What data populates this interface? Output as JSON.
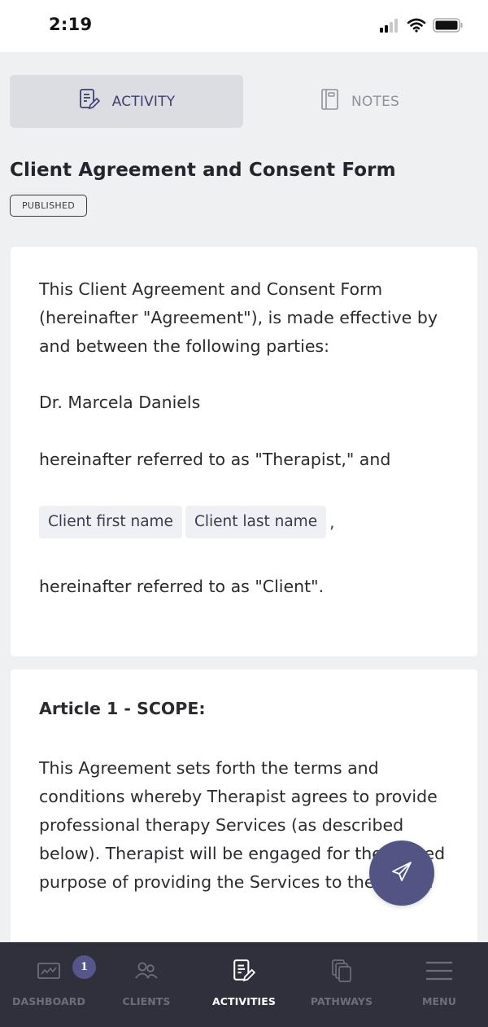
{
  "status_bar": {
    "time": "2:19",
    "icons": [
      "cellular-signal-icon",
      "wifi-icon",
      "battery-icon"
    ]
  },
  "tabs": [
    {
      "label": "ACTIVITY",
      "icon": "edit-document-icon",
      "active": true
    },
    {
      "label": "NOTES",
      "icon": "notebook-icon",
      "active": false
    }
  ],
  "page": {
    "title": "Client Agreement and Consent Form",
    "status_badge": "PUBLISHED"
  },
  "card1": {
    "intro": "This Client Agreement and Consent Form (hereinafter \"Agreement\"), is made effective by and between the following parties:",
    "therapist_name": "Dr. Marcela Daniels",
    "therapist_ref": "hereinafter referred to as \"Therapist,\" and",
    "fields": [
      {
        "label": "Client first name"
      },
      {
        "label": "Client last name"
      }
    ],
    "fields_suffix": ",",
    "client_ref": "hereinafter referred to as \"Client\"."
  },
  "card2": {
    "heading": "Article 1 - SCOPE:",
    "body": "This Agreement sets forth the terms and conditions whereby Therapist agrees to provide professional therapy Services (as described below). Therapist will be engaged for the limited purpose of providing the Services to the Client."
  },
  "fab": {
    "icon": "send-paper-plane-icon"
  },
  "bottom_nav": {
    "items": [
      {
        "label": "DASHBOARD",
        "icon": "dashboard-chart-icon",
        "badge": "1",
        "active": false
      },
      {
        "label": "CLIENTS",
        "icon": "users-icon",
        "active": false
      },
      {
        "label": "ACTIVITIES",
        "icon": "edit-document-icon",
        "active": true
      },
      {
        "label": "PATHWAYS",
        "icon": "stacked-pages-icon",
        "active": false
      },
      {
        "label": "MENU",
        "icon": "hamburger-menu-icon",
        "active": false
      }
    ]
  },
  "colors": {
    "accent": "#525584",
    "background": "#eff0f2",
    "nav_background": "#2f303c",
    "active_tab_bg": "#dcdde2"
  }
}
